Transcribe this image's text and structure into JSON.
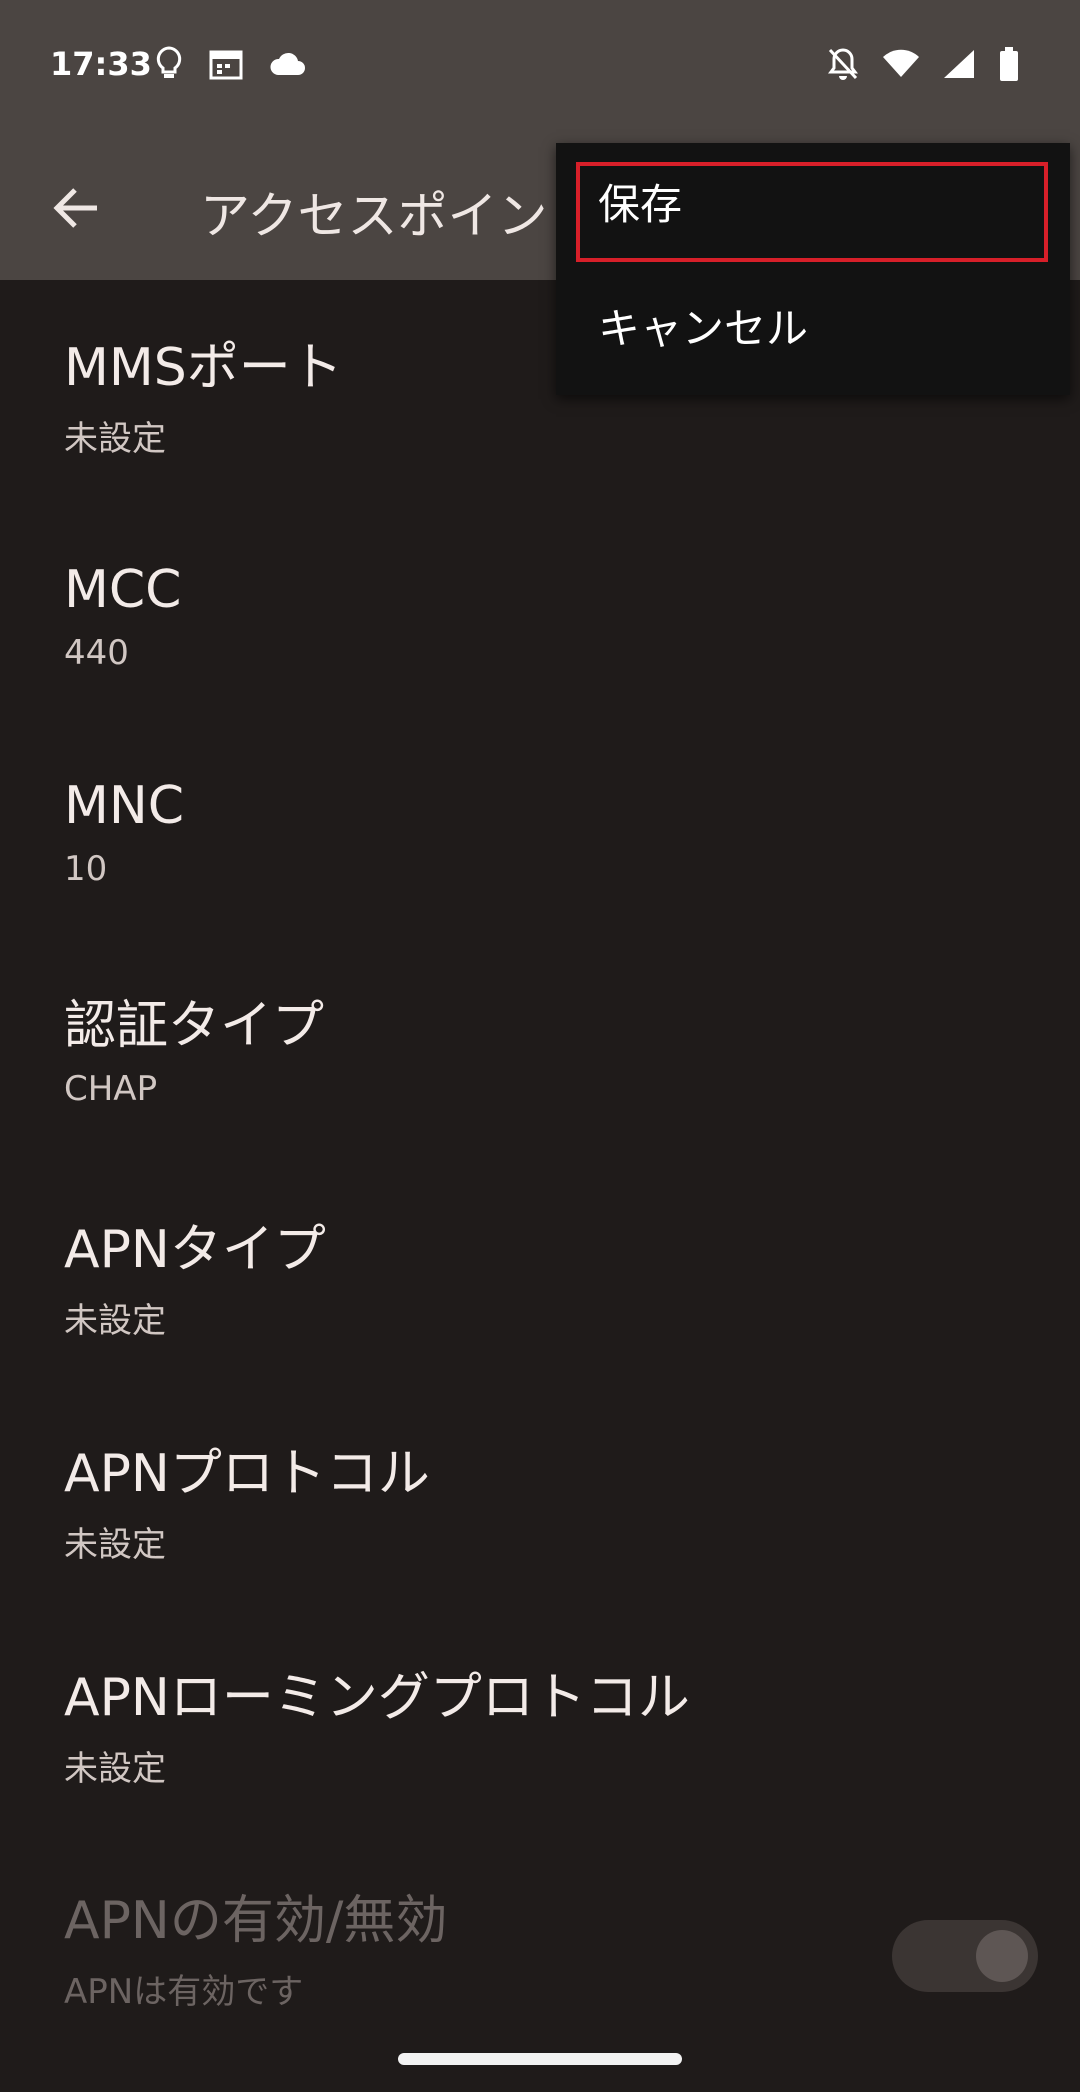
{
  "status_bar": {
    "time": "17:33",
    "left_icons": [
      "lightbulb-icon",
      "calendar-icon",
      "cloud-icon"
    ],
    "right_icons": [
      "notifications-off-icon",
      "wifi-icon",
      "cell-signal-icon",
      "battery-icon"
    ]
  },
  "app_bar": {
    "title": "アクセスポイン",
    "back_icon": "back-arrow-icon"
  },
  "settings": [
    {
      "title": "MMSポート",
      "summary": "未設定"
    },
    {
      "title": "MCC",
      "summary": "440"
    },
    {
      "title": "MNC",
      "summary": "10"
    },
    {
      "title": "認証タイプ",
      "summary": "CHAP"
    },
    {
      "title": "APNタイプ",
      "summary": "未設定"
    },
    {
      "title": "APNプロトコル",
      "summary": "未設定"
    },
    {
      "title": "APNローミングプロトコル",
      "summary": "未設定"
    },
    {
      "title": "APNの有効/無効",
      "summary": "APNは有効です",
      "disabled": true
    }
  ],
  "overflow_menu": {
    "items": [
      "保存",
      "キャンセル"
    ],
    "highlighted_color": "#d71f29"
  },
  "colors": {
    "bar_background": "#4b4542",
    "page_background": "#1f1b1a",
    "menu_background": "#121212"
  }
}
